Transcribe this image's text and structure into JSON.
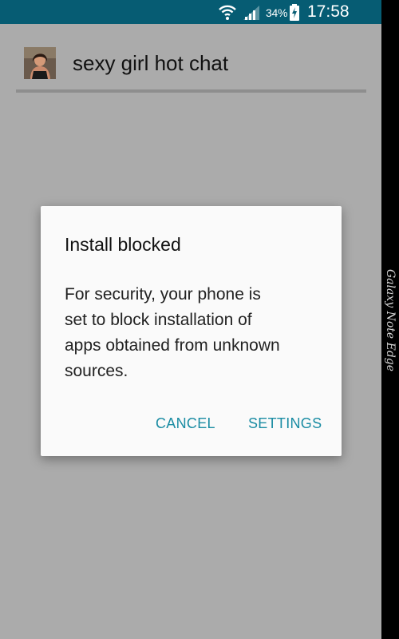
{
  "status_bar": {
    "battery_percent": "34%",
    "time": "17:58",
    "background_color": "#065c73",
    "icons": [
      "wifi-icon",
      "signal-icon",
      "battery-charging-icon"
    ]
  },
  "app_bar": {
    "title": "sexy girl hot chat",
    "icon": "app-avatar-photo"
  },
  "dialog": {
    "title": "Install blocked",
    "message_lines": [
      "For security, your phone is",
      "set to block installation of",
      "apps obtained from unknown",
      "sources."
    ],
    "buttons": {
      "cancel": "CANCEL",
      "settings": "SETTINGS"
    },
    "button_color": "#1a8ca3"
  },
  "side_edge": {
    "label": "Galaxy Note Edge"
  }
}
